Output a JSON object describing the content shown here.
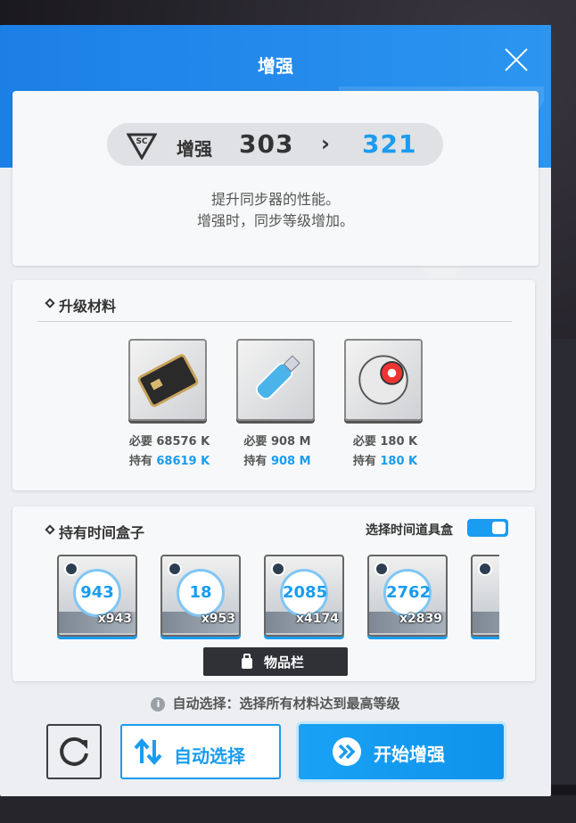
{
  "dialog": {
    "title": "增强",
    "close_icon": "close-icon"
  },
  "level": {
    "label": "增强",
    "from": "303",
    "arrow": "›",
    "to": "321",
    "logo_text": "SC"
  },
  "description": {
    "line1": "提升同步器的性能。",
    "line2": "增强时，同步等级增加。"
  },
  "materials": {
    "title": "升级材料",
    "items": [
      {
        "icon": "credit-card-icon",
        "required_label": "必要",
        "required": "68576 K",
        "owned_label": "持有",
        "owned": "68619 K"
      },
      {
        "icon": "usb-drive-icon",
        "required_label": "必要",
        "required": "908 M",
        "owned_label": "持有",
        "owned": "908 M"
      },
      {
        "icon": "core-orb-icon",
        "required_label": "必要",
        "required": "180 K",
        "owned_label": "持有",
        "owned": "180 K"
      }
    ]
  },
  "time_boxes": {
    "title": "持有时间盒子",
    "toggle_label": "选择时间道具盒",
    "toggle_on": true,
    "items": [
      {
        "value": "943",
        "count": "x943"
      },
      {
        "value": "18",
        "count": "x953"
      },
      {
        "value": "2085",
        "count": "x4174"
      },
      {
        "value": "2762",
        "count": "x2839"
      },
      {
        "value": "",
        "count": ""
      }
    ],
    "inventory_label": "物品栏"
  },
  "hint": {
    "text": "自动选择：选择所有材料达到最高等级"
  },
  "buttons": {
    "reset_icon": "refresh-icon",
    "auto_label": "自动选择",
    "start_label": "开始增强"
  },
  "colors": {
    "accent": "#1a9cf0",
    "header": "#1c7fe6",
    "panel": "#eceef1"
  }
}
